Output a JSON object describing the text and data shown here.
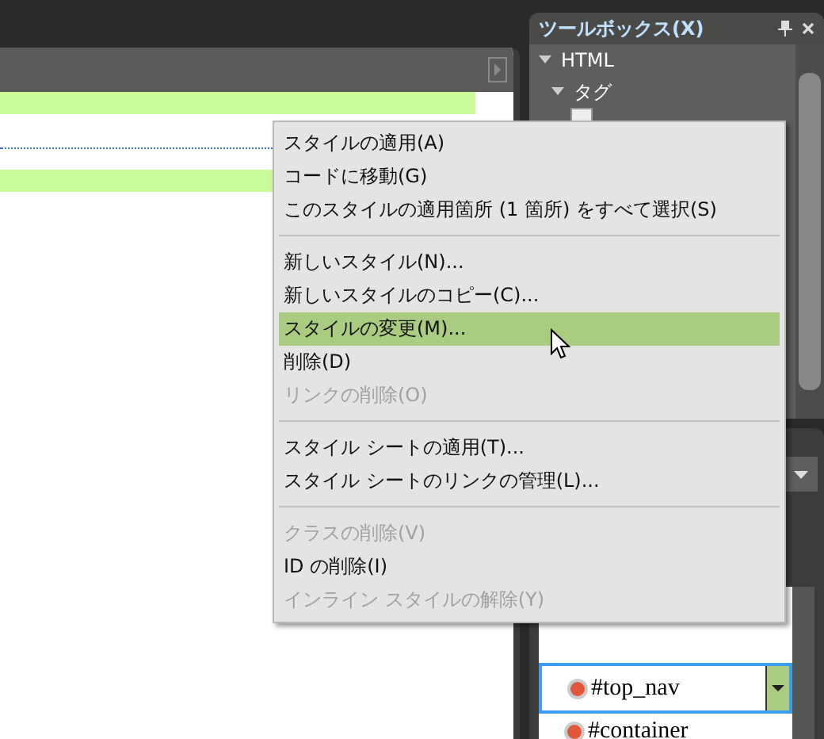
{
  "toolbox": {
    "title": "ツールボックス(X)",
    "tree": [
      {
        "label": "HTML",
        "expanded": true,
        "children": [
          {
            "label": "タグ",
            "expanded": true
          }
        ]
      }
    ]
  },
  "styles_panel": {
    "selector": {
      "value": "#top_nav"
    },
    "items": [
      {
        "label": "#container"
      }
    ]
  },
  "context_menu": [
    {
      "kind": "item",
      "label": "スタイルの適用(A)",
      "disabled": false,
      "selected": false
    },
    {
      "kind": "item",
      "label": "コードに移動(G)",
      "disabled": false,
      "selected": false
    },
    {
      "kind": "item",
      "label": "このスタイルの適用箇所 (1 箇所) をすべて選択(S)",
      "disabled": false,
      "selected": false
    },
    {
      "kind": "separator"
    },
    {
      "kind": "item",
      "label": "新しいスタイル(N)...",
      "disabled": false,
      "selected": false
    },
    {
      "kind": "item",
      "label": "新しいスタイルのコピー(C)...",
      "disabled": false,
      "selected": false
    },
    {
      "kind": "item",
      "label": "スタイルの変更(M)...",
      "disabled": false,
      "selected": true
    },
    {
      "kind": "item",
      "label": "削除(D)",
      "disabled": false,
      "selected": false
    },
    {
      "kind": "item",
      "label": "リンクの削除(O)",
      "disabled": true,
      "selected": false
    },
    {
      "kind": "separator"
    },
    {
      "kind": "item",
      "label": "スタイル シートの適用(T)...",
      "disabled": false,
      "selected": false
    },
    {
      "kind": "item",
      "label": "スタイル シートのリンクの管理(L)...",
      "disabled": false,
      "selected": false
    },
    {
      "kind": "separator"
    },
    {
      "kind": "item",
      "label": "クラスの削除(V)",
      "disabled": true,
      "selected": false
    },
    {
      "kind": "item",
      "label": "ID の削除(I)",
      "disabled": false,
      "selected": false
    },
    {
      "kind": "item",
      "label": "インライン スタイルの解除(Y)",
      "disabled": true,
      "selected": false
    }
  ]
}
